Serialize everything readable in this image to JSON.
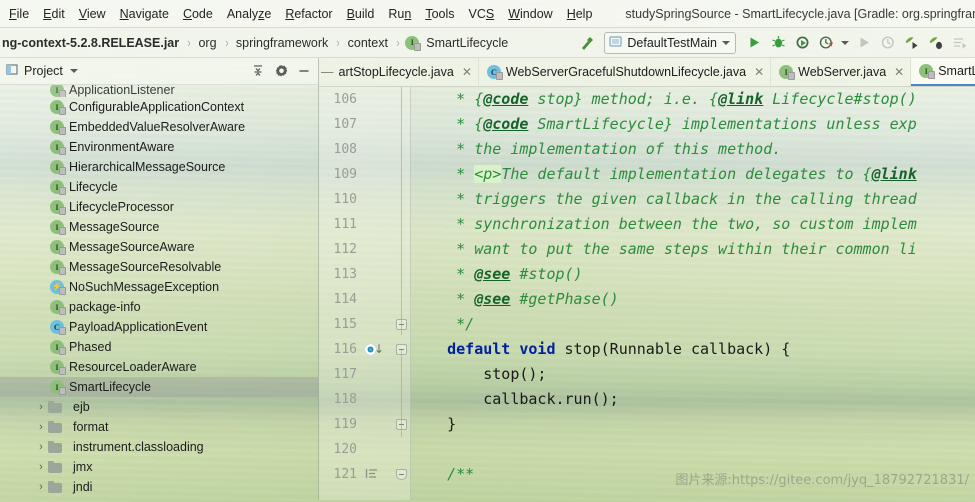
{
  "window": {
    "title": "studySpringSource - SmartLifecycle.java [Gradle: org.springframe"
  },
  "menubar": {
    "items": [
      {
        "label": "File",
        "mnemonic": "F"
      },
      {
        "label": "Edit",
        "mnemonic": "E"
      },
      {
        "label": "View",
        "mnemonic": "V"
      },
      {
        "label": "Navigate",
        "mnemonic": "N"
      },
      {
        "label": "Code",
        "mnemonic": "C"
      },
      {
        "label": "Analyze",
        "mnemonic": "z"
      },
      {
        "label": "Refactor",
        "mnemonic": "R"
      },
      {
        "label": "Build",
        "mnemonic": "B"
      },
      {
        "label": "Run",
        "mnemonic": "n"
      },
      {
        "label": "Tools",
        "mnemonic": "T"
      },
      {
        "label": "VCS",
        "mnemonic": "S"
      },
      {
        "label": "Window",
        "mnemonic": "W"
      },
      {
        "label": "Help",
        "mnemonic": "H"
      }
    ]
  },
  "breadcrumb": {
    "items": [
      {
        "label": "ng-context-5.2.8.RELEASE.jar",
        "bold": true,
        "icon": null
      },
      {
        "label": "org",
        "bold": false,
        "icon": null
      },
      {
        "label": "springframework",
        "bold": false,
        "icon": null
      },
      {
        "label": "context",
        "bold": false,
        "icon": null
      },
      {
        "label": "SmartLifecycle",
        "bold": false,
        "icon": "interface-icon"
      }
    ],
    "separator": "›"
  },
  "toolbar": {
    "build_label": "build-hammer-icon",
    "run_config": {
      "label": "DefaultTestMain",
      "dropdown_icon": "chevron-down-icon",
      "config_icon": "application-config-icon"
    },
    "buttons": [
      {
        "name": "run-button",
        "icon": "play-icon",
        "enabled": true
      },
      {
        "name": "debug-button",
        "icon": "bug-icon",
        "enabled": true
      },
      {
        "name": "run-with-coverage-button",
        "icon": "coverage-icon",
        "enabled": true
      },
      {
        "name": "profile-button",
        "icon": "profiler-icon",
        "enabled": true
      },
      {
        "name": "profile-dropdown",
        "icon": "chevron-down-icon",
        "enabled": true
      },
      {
        "name": "rerun-button",
        "icon": "play-icon",
        "enabled": false
      },
      {
        "name": "stop-coverage-button",
        "icon": "coverage-icon",
        "enabled": false
      },
      {
        "name": "attach-profiler-button",
        "icon": "leaf-run-icon",
        "enabled": true
      },
      {
        "name": "attach-debugger-button",
        "icon": "leaf-bug-icon",
        "enabled": true
      },
      {
        "name": "run-dashboard-button",
        "icon": "list-run-icon",
        "enabled": false
      }
    ]
  },
  "project_panel": {
    "title": "Project",
    "title_dropdown": "chevron-down-icon",
    "header_buttons": [
      {
        "name": "collapse-all-button",
        "icon": "collapse-all-icon"
      },
      {
        "name": "settings-button",
        "icon": "gear-icon"
      },
      {
        "name": "hide-button",
        "icon": "minus-icon"
      }
    ],
    "tree": [
      {
        "label": "ApplicationListener",
        "kind": "interface",
        "indent": 3,
        "clipped": true,
        "selected": false
      },
      {
        "label": "ConfigurableApplicationContext",
        "kind": "interface",
        "indent": 3,
        "clipped": false,
        "selected": false
      },
      {
        "label": "EmbeddedValueResolverAware",
        "kind": "interface",
        "indent": 3,
        "clipped": false,
        "selected": false
      },
      {
        "label": "EnvironmentAware",
        "kind": "interface",
        "indent": 3,
        "clipped": false,
        "selected": false
      },
      {
        "label": "HierarchicalMessageSource",
        "kind": "interface",
        "indent": 3,
        "clipped": false,
        "selected": false
      },
      {
        "label": "Lifecycle",
        "kind": "interface",
        "indent": 3,
        "clipped": false,
        "selected": false
      },
      {
        "label": "LifecycleProcessor",
        "kind": "interface",
        "indent": 3,
        "clipped": false,
        "selected": false
      },
      {
        "label": "MessageSource",
        "kind": "interface",
        "indent": 3,
        "clipped": false,
        "selected": false
      },
      {
        "label": "MessageSourceAware",
        "kind": "interface",
        "indent": 3,
        "clipped": false,
        "selected": false
      },
      {
        "label": "MessageSourceResolvable",
        "kind": "interface",
        "indent": 3,
        "clipped": false,
        "selected": false
      },
      {
        "label": "NoSuchMessageException",
        "kind": "exception",
        "indent": 3,
        "clipped": false,
        "selected": false
      },
      {
        "label": "package-info",
        "kind": "interface",
        "indent": 3,
        "clipped": false,
        "selected": false
      },
      {
        "label": "PayloadApplicationEvent",
        "kind": "class",
        "indent": 3,
        "clipped": false,
        "selected": false
      },
      {
        "label": "Phased",
        "kind": "interface",
        "indent": 3,
        "clipped": false,
        "selected": false
      },
      {
        "label": "ResourceLoaderAware",
        "kind": "interface",
        "indent": 3,
        "clipped": false,
        "selected": false
      },
      {
        "label": "SmartLifecycle",
        "kind": "interface",
        "indent": 3,
        "clipped": false,
        "selected": true
      },
      {
        "label": "ejb",
        "kind": "folder",
        "indent": 2,
        "clipped": false,
        "selected": false
      },
      {
        "label": "format",
        "kind": "folder",
        "indent": 2,
        "clipped": false,
        "selected": false
      },
      {
        "label": "instrument.classloading",
        "kind": "folder",
        "indent": 2,
        "clipped": false,
        "selected": false
      },
      {
        "label": "jmx",
        "kind": "folder",
        "indent": 2,
        "clipped": false,
        "selected": false
      },
      {
        "label": "jndi",
        "kind": "folder",
        "indent": 2,
        "clipped": false,
        "selected": false
      }
    ],
    "folder_chevron": "›"
  },
  "editor": {
    "tabs": [
      {
        "label": "artStopLifecycle.java",
        "icon": null,
        "active": false,
        "clipped": true,
        "closable": true
      },
      {
        "label": "WebServerGracefulShutdownLifecycle.java",
        "icon": "class-icon",
        "active": false,
        "clipped": false,
        "closable": true
      },
      {
        "label": "WebServer.java",
        "icon": "interface-icon",
        "active": false,
        "clipped": false,
        "closable": true
      },
      {
        "label": "SmartLifecy",
        "icon": "interface-icon",
        "active": true,
        "clipped": false,
        "closable": false
      }
    ],
    "first_line_number": 106,
    "lines": [
      {
        "num": 106,
        "gutter": null,
        "fold": null,
        "tokens": [
          {
            "t": "     * ",
            "c": "cm"
          },
          {
            "t": "{",
            "c": "cm"
          },
          {
            "t": "@code",
            "c": "ctag"
          },
          {
            "t": " stop} method; i.e. ",
            "c": "cm"
          },
          {
            "t": "{",
            "c": "cm"
          },
          {
            "t": "@link",
            "c": "ctag"
          },
          {
            "t": " Lifecycle#stop()",
            "c": "cm"
          }
        ]
      },
      {
        "num": 107,
        "gutter": null,
        "fold": null,
        "tokens": [
          {
            "t": "     * ",
            "c": "cm"
          },
          {
            "t": "{",
            "c": "cm"
          },
          {
            "t": "@code",
            "c": "ctag"
          },
          {
            "t": " SmartLifecycle} implementations unless exp",
            "c": "cm"
          }
        ]
      },
      {
        "num": 108,
        "gutter": null,
        "fold": null,
        "tokens": [
          {
            "t": "     * the implementation of this method.",
            "c": "cm"
          }
        ]
      },
      {
        "num": 109,
        "gutter": null,
        "fold": null,
        "tokens": [
          {
            "t": "     * ",
            "c": "cm"
          },
          {
            "t": "<p>",
            "c": "chtml"
          },
          {
            "t": "The default implementation delegates to ",
            "c": "cm"
          },
          {
            "t": "{",
            "c": "cm"
          },
          {
            "t": "@link",
            "c": "ctag"
          }
        ]
      },
      {
        "num": 110,
        "gutter": null,
        "fold": null,
        "tokens": [
          {
            "t": "     * triggers the given callback in the calling thread",
            "c": "cm"
          }
        ]
      },
      {
        "num": 111,
        "gutter": null,
        "fold": null,
        "tokens": [
          {
            "t": "     * synchronization between the two, so custom implem",
            "c": "cm"
          }
        ]
      },
      {
        "num": 112,
        "gutter": null,
        "fold": null,
        "tokens": [
          {
            "t": "     * want to put the same steps within their common li",
            "c": "cm"
          }
        ]
      },
      {
        "num": 113,
        "gutter": null,
        "fold": null,
        "tokens": [
          {
            "t": "     * ",
            "c": "cm"
          },
          {
            "t": "@see",
            "c": "ctag"
          },
          {
            "t": " #stop()",
            "c": "cm"
          }
        ]
      },
      {
        "num": 114,
        "gutter": null,
        "fold": null,
        "tokens": [
          {
            "t": "     * ",
            "c": "cm"
          },
          {
            "t": "@see",
            "c": "ctag"
          },
          {
            "t": " #getPhase()",
            "c": "cm"
          }
        ]
      },
      {
        "num": 115,
        "gutter": null,
        "fold": "end",
        "tokens": [
          {
            "t": "     */",
            "c": "cm"
          }
        ]
      },
      {
        "num": 116,
        "gutter": "implemented-method-icon",
        "fold": "start",
        "tokens": [
          {
            "t": "    ",
            "c": "cid"
          },
          {
            "t": "default void",
            "c": "ckw"
          },
          {
            "t": " stop(Runnable callback) {",
            "c": "cid"
          }
        ]
      },
      {
        "num": 117,
        "gutter": null,
        "fold": null,
        "tokens": [
          {
            "t": "        stop();",
            "c": "cid"
          }
        ]
      },
      {
        "num": 118,
        "gutter": null,
        "fold": null,
        "tokens": [
          {
            "t": "        callback.run();",
            "c": "cid"
          }
        ]
      },
      {
        "num": 119,
        "gutter": null,
        "fold": "end",
        "tokens": [
          {
            "t": "    }",
            "c": "cid"
          }
        ]
      },
      {
        "num": 120,
        "gutter": null,
        "fold": null,
        "tokens": []
      },
      {
        "num": 121,
        "gutter": "javadoc-lines-icon",
        "fold": "shield",
        "tokens": [
          {
            "t": "    ",
            "c": "cid"
          },
          {
            "t": "/**",
            "c": "cstart"
          }
        ]
      }
    ],
    "watermark": "图片来源:https://gitee.com/jyq_18792721831/"
  },
  "colors": {
    "accent_blue": "#4a86c8",
    "keyword": "#00209f",
    "javadoc": "#2e8b3e",
    "javadoc_tag": "#15632b",
    "html_tag_bg": "#d9f2c9",
    "interface_icon": "#8ec07c",
    "class_icon": "#6fc0df",
    "run_green": "#389e3c"
  }
}
